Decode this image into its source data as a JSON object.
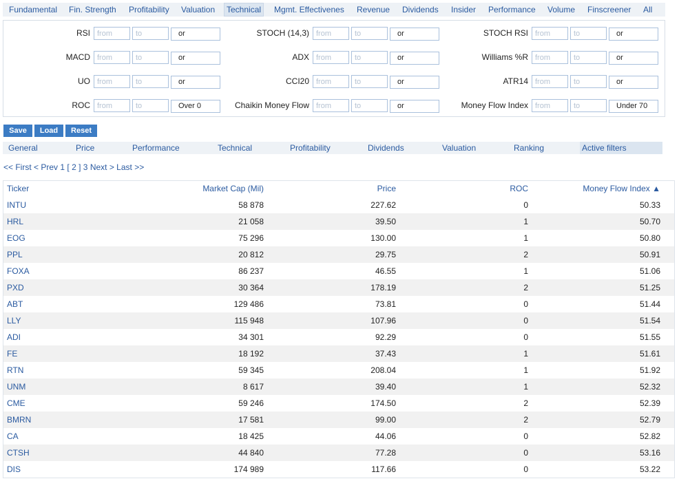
{
  "top_tabs": [
    "Fundamental",
    "Fin. Strength",
    "Profitability",
    "Valuation",
    "Technical",
    "Mgmt. Effectivenes",
    "Revenue",
    "Dividends",
    "Insider",
    "Performance",
    "Volume",
    "Finscreener",
    "All"
  ],
  "active_top_tab": "Technical",
  "filters": [
    {
      "label": "RSI",
      "from": "",
      "to": "",
      "op": "or"
    },
    {
      "label": "STOCH (14,3)",
      "from": "",
      "to": "",
      "op": "or"
    },
    {
      "label": "STOCH RSI",
      "from": "",
      "to": "",
      "op": "or"
    },
    {
      "label": "MACD",
      "from": "",
      "to": "",
      "op": "or"
    },
    {
      "label": "ADX",
      "from": "",
      "to": "",
      "op": "or"
    },
    {
      "label": "Williams %R",
      "from": "",
      "to": "",
      "op": "or"
    },
    {
      "label": "UO",
      "from": "",
      "to": "",
      "op": "or"
    },
    {
      "label": "CCI20",
      "from": "",
      "to": "",
      "op": "or"
    },
    {
      "label": "ATR14",
      "from": "",
      "to": "",
      "op": "or"
    },
    {
      "label": "ROC",
      "from": "",
      "to": "",
      "op": "Over 0"
    },
    {
      "label": "Chaikin Money Flow",
      "from": "",
      "to": "",
      "op": "or"
    },
    {
      "label": "Money Flow Index",
      "from": "",
      "to": "",
      "op": "Under 70"
    }
  ],
  "placeholders": {
    "from": "from",
    "to": "to"
  },
  "buttons": {
    "save": "Save",
    "load": "Load",
    "reset": "Reset"
  },
  "sub_tabs": [
    "General",
    "Price",
    "Performance",
    "Technical",
    "Profitability",
    "Dividends",
    "Valuation",
    "Ranking",
    "Active filters"
  ],
  "active_sub_tab": "Active filters",
  "pager": {
    "first": "<< First",
    "prev": "< Prev",
    "pages": [
      "1",
      "[ 2 ]",
      "3"
    ],
    "next": "Next >",
    "last": "Last >>"
  },
  "table": {
    "headers": {
      "ticker": "Ticker",
      "market_cap": "Market Cap (Mil)",
      "price": "Price",
      "roc": "ROC",
      "mfi": "Money Flow Index ▲"
    },
    "rows": [
      {
        "ticker": "INTU",
        "market_cap": "58 878",
        "price": "227.62",
        "roc": "0",
        "mfi": "50.33"
      },
      {
        "ticker": "HRL",
        "market_cap": "21 058",
        "price": "39.50",
        "roc": "1",
        "mfi": "50.70"
      },
      {
        "ticker": "EOG",
        "market_cap": "75 296",
        "price": "130.00",
        "roc": "1",
        "mfi": "50.80"
      },
      {
        "ticker": "PPL",
        "market_cap": "20 812",
        "price": "29.75",
        "roc": "2",
        "mfi": "50.91"
      },
      {
        "ticker": "FOXA",
        "market_cap": "86 237",
        "price": "46.55",
        "roc": "1",
        "mfi": "51.06"
      },
      {
        "ticker": "PXD",
        "market_cap": "30 364",
        "price": "178.19",
        "roc": "2",
        "mfi": "51.25"
      },
      {
        "ticker": "ABT",
        "market_cap": "129 486",
        "price": "73.81",
        "roc": "0",
        "mfi": "51.44"
      },
      {
        "ticker": "LLY",
        "market_cap": "115 948",
        "price": "107.96",
        "roc": "0",
        "mfi": "51.54"
      },
      {
        "ticker": "ADI",
        "market_cap": "34 301",
        "price": "92.29",
        "roc": "0",
        "mfi": "51.55"
      },
      {
        "ticker": "FE",
        "market_cap": "18 192",
        "price": "37.43",
        "roc": "1",
        "mfi": "51.61"
      },
      {
        "ticker": "RTN",
        "market_cap": "59 345",
        "price": "208.04",
        "roc": "1",
        "mfi": "51.92"
      },
      {
        "ticker": "UNM",
        "market_cap": "8 617",
        "price": "39.40",
        "roc": "1",
        "mfi": "52.32"
      },
      {
        "ticker": "CME",
        "market_cap": "59 246",
        "price": "174.50",
        "roc": "2",
        "mfi": "52.39"
      },
      {
        "ticker": "BMRN",
        "market_cap": "17 581",
        "price": "99.00",
        "roc": "2",
        "mfi": "52.79"
      },
      {
        "ticker": "CA",
        "market_cap": "18 425",
        "price": "44.06",
        "roc": "0",
        "mfi": "52.82"
      },
      {
        "ticker": "CTSH",
        "market_cap": "44 840",
        "price": "77.28",
        "roc": "0",
        "mfi": "53.16"
      },
      {
        "ticker": "DIS",
        "market_cap": "174 989",
        "price": "117.66",
        "roc": "0",
        "mfi": "53.22"
      }
    ]
  },
  "colors": {
    "link": "#2a5aa0",
    "button": "#3c7cc4",
    "tab_bar": "#eef2f6",
    "row_alt": "#f1f1f1"
  }
}
